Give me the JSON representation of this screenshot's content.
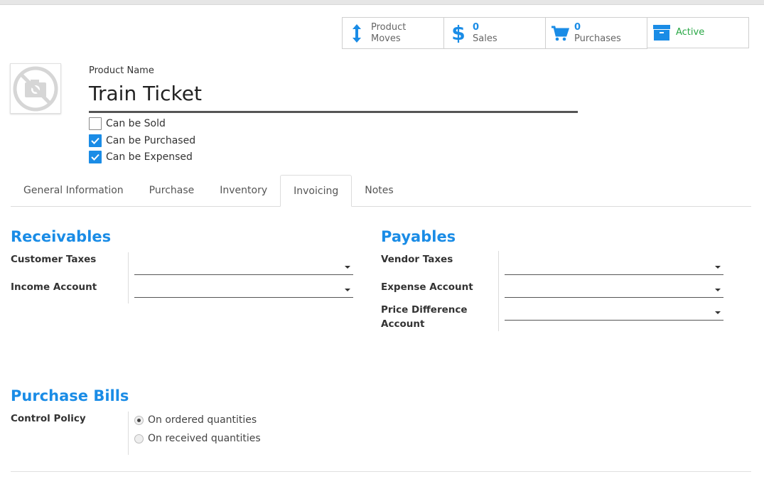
{
  "smart_buttons": [
    {
      "number": "",
      "label1": "Product",
      "label2": "Moves",
      "icon": "up-down-arrow-icon"
    },
    {
      "number": "0",
      "label1": "",
      "label2": "Sales",
      "icon": "dollar-icon"
    },
    {
      "number": "0",
      "label1": "",
      "label2": "Purchases",
      "icon": "cart-icon"
    },
    {
      "label": "Active",
      "icon": "archive-icon"
    }
  ],
  "product": {
    "name_label": "Product Name",
    "name": "Train Ticket",
    "image_icon": "no-image-camera-icon"
  },
  "checkboxes": [
    {
      "label": "Can be Sold",
      "checked": false
    },
    {
      "label": "Can be Purchased",
      "checked": true
    },
    {
      "label": "Can be Expensed",
      "checked": true
    }
  ],
  "tabs": [
    {
      "label": "General Information",
      "active": false
    },
    {
      "label": "Purchase",
      "active": false
    },
    {
      "label": "Inventory",
      "active": false
    },
    {
      "label": "Invoicing",
      "active": true
    },
    {
      "label": "Notes",
      "active": false
    }
  ],
  "receivables": {
    "title": "Receivables",
    "fields": [
      {
        "label": "Customer Taxes",
        "value": ""
      },
      {
        "label": "Income Account",
        "value": ""
      }
    ]
  },
  "payables": {
    "title": "Payables",
    "fields": [
      {
        "label": "Vendor Taxes",
        "value": ""
      },
      {
        "label": "Expense Account",
        "value": ""
      },
      {
        "label": "Price Difference Account",
        "value": ""
      }
    ]
  },
  "purchase_bills": {
    "title": "Purchase Bills",
    "control_label": "Control Policy",
    "options": [
      {
        "label": "On ordered quantities",
        "selected": true
      },
      {
        "label": "On received quantities",
        "selected": false
      }
    ]
  },
  "colors": {
    "accent": "#1a8ce6",
    "active_green": "#28a745"
  }
}
